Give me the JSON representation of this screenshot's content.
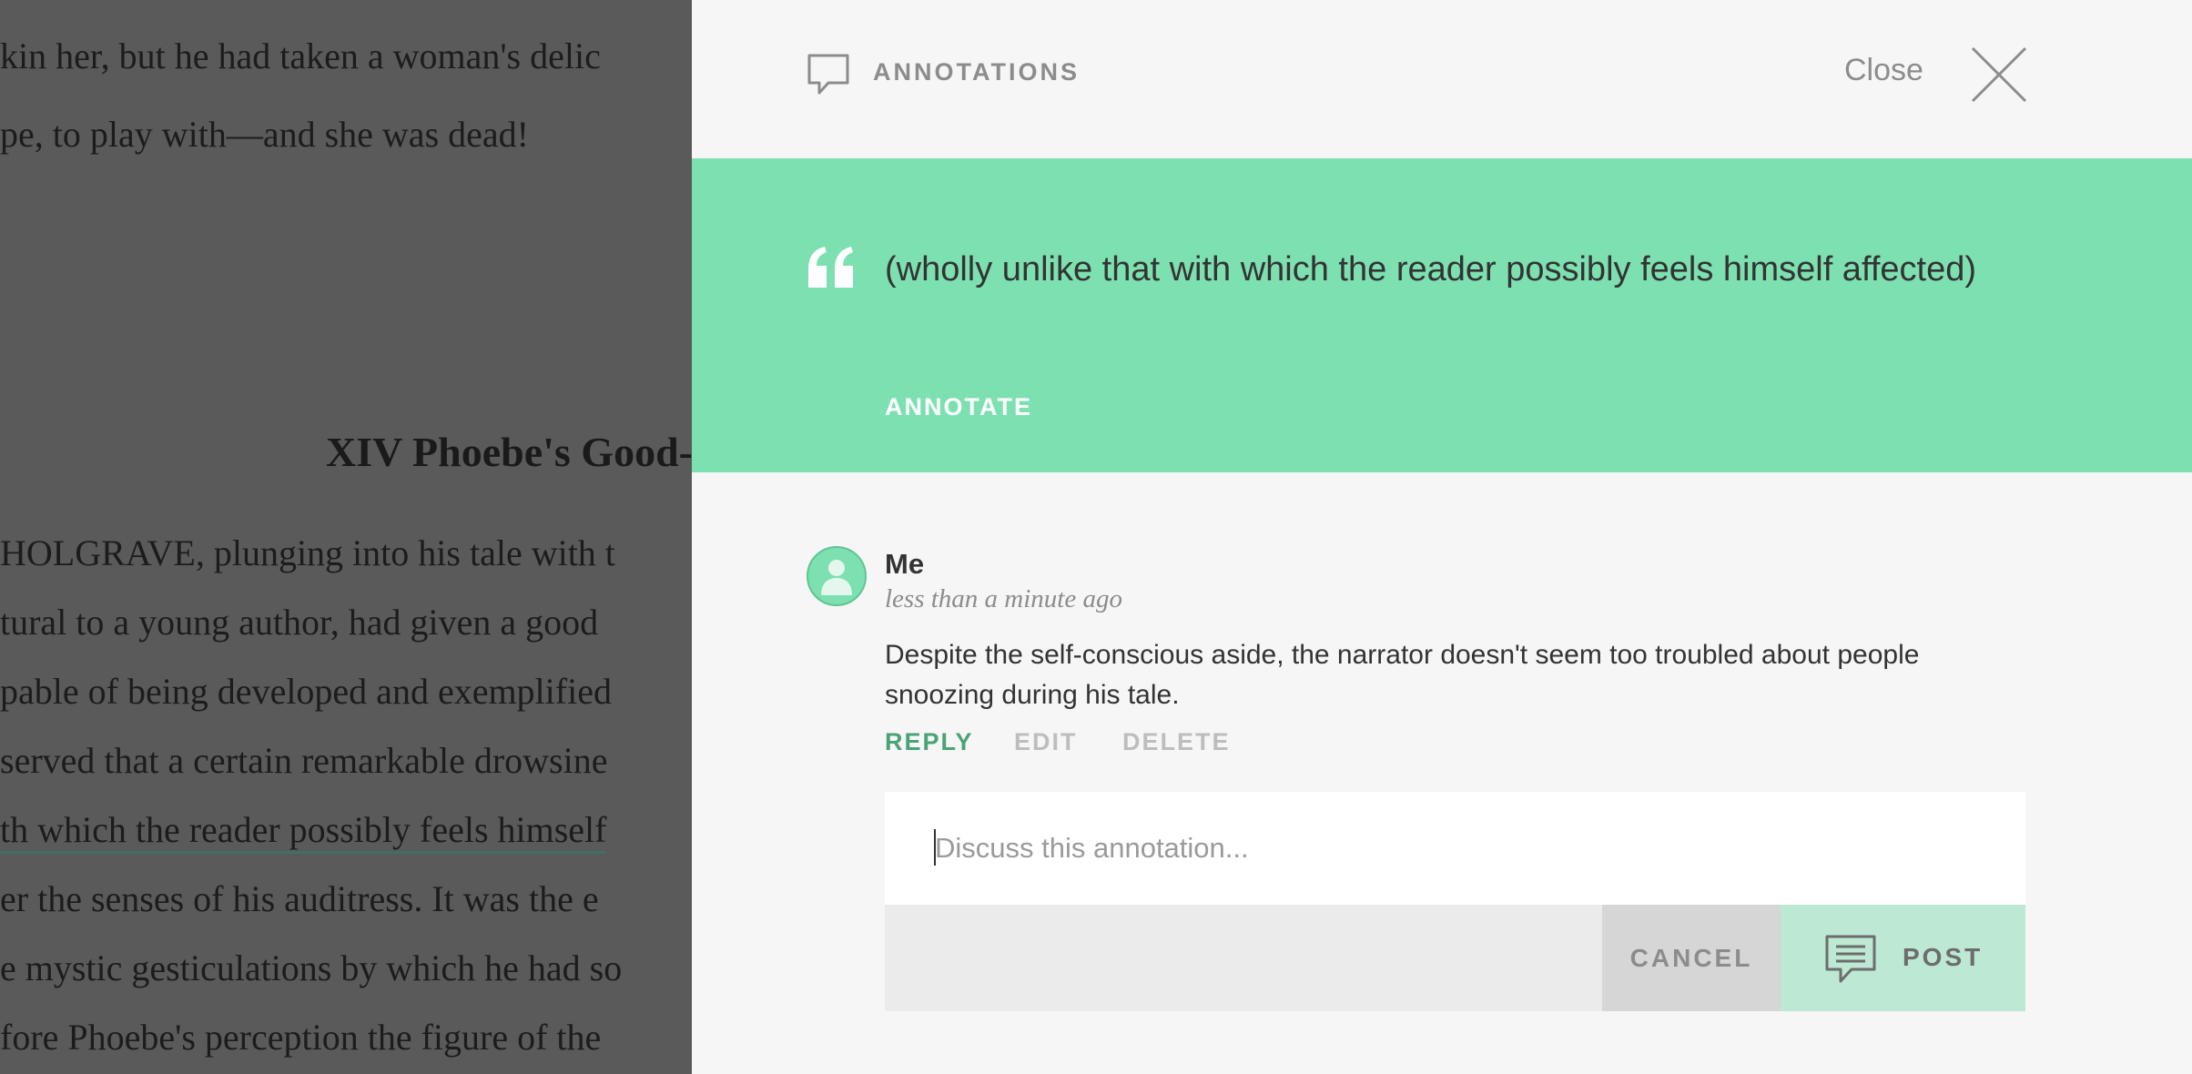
{
  "reader": {
    "top_lines": [
      "kin her, but he had taken a woman's delic",
      "pe, to play with—and she was dead!"
    ],
    "chapter_heading": "XIV Phoebe's Good-",
    "body_lines": [
      " HOLGRAVE, plunging into his tale with t",
      "tural to a young author, had given a good",
      "pable of being developed and exemplified",
      "served that a certain remarkable drowsine",
      "th which the reader possibly feels himself",
      "er the senses of his auditress. It was the e",
      "e mystic gesticulations by which he had so",
      "fore Phoebe's perception the figure of the"
    ]
  },
  "panel": {
    "header": {
      "title": "ANNOTATIONS",
      "title_icon": "speech-bubble-icon",
      "close_label": "Close",
      "close_icon": "close-x-icon"
    },
    "quote": {
      "icon": "quote-mark-icon",
      "text": "(wholly unlike that with which the reader possibly feels himself affected)",
      "annotate_label": "ANNOTATE"
    },
    "comment": {
      "author": "Me",
      "time": "less than a minute ago",
      "body": "Despite the self-conscious aside, the narrator doesn't seem too troubled about people snoozing during his tale.",
      "actions": {
        "reply": "REPLY",
        "edit": "EDIT",
        "delete": "DELETE"
      }
    },
    "reply_form": {
      "placeholder": "Discuss this annotation...",
      "value": "",
      "cancel_label": "CANCEL",
      "post_label": "POST",
      "post_icon": "chat-post-icon"
    }
  },
  "colors": {
    "accent": "#7de0b0",
    "reply_green": "#4aa377",
    "post_bg": "#bde8d3",
    "overlay": "#5a5a5a"
  }
}
